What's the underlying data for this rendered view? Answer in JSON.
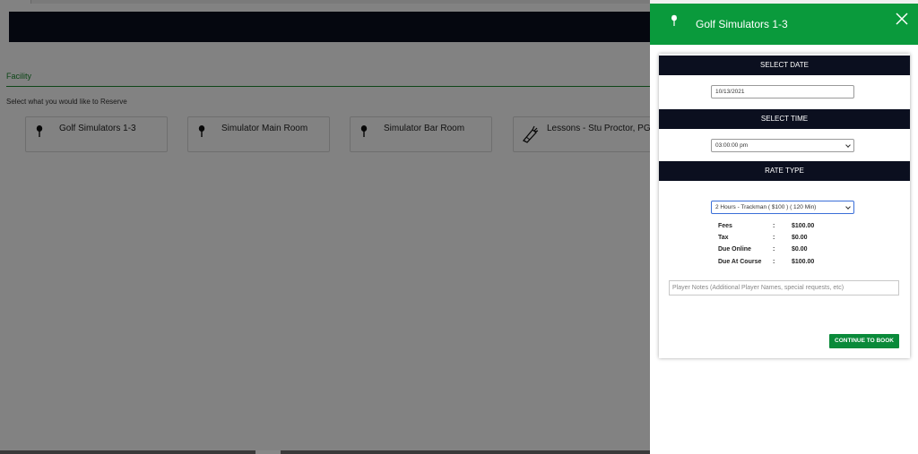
{
  "facility": {
    "title": "Facility",
    "prompt": "Select what you would like to Reserve",
    "cards": [
      {
        "label": "Golf Simulators 1-3",
        "icon": "golf-tee-icon"
      },
      {
        "label": "Simulator Main Room",
        "icon": "golf-tee-icon"
      },
      {
        "label": "Simulator Bar Room",
        "icon": "golf-tee-icon"
      },
      {
        "label": "Lessons - Stu Proctor, PGA",
        "icon": "golf-bag-icon"
      }
    ]
  },
  "panel": {
    "title": "Golf Simulators 1-3",
    "close_icon": "close-icon",
    "select_date_label": "SELECT DATE",
    "date_value": "10/13/2021",
    "select_time_label": "SELECT TIME",
    "time_value": "03:00:00 pm",
    "rate_type_label": "RATE TYPE",
    "rate_value": "2 Hours - Trackman ( $100 ) ( 120 Min)",
    "fees": [
      {
        "label": "Fees",
        "sep": ":",
        "value": "$100.00"
      },
      {
        "label": "Tax",
        "sep": ":",
        "value": "$0.00"
      },
      {
        "label": "Due Online",
        "sep": ":",
        "value": "$0.00"
      },
      {
        "label": "Due At Course",
        "sep": ":",
        "value": "$100.00"
      }
    ],
    "notes_placeholder": "Player Notes (Additional Player Names, special requests, etc)",
    "continue_label": "CONTINUE TO BOOK"
  },
  "colors": {
    "accent_green": "#0a9a3c",
    "header_navy": "#0b0f1f"
  }
}
